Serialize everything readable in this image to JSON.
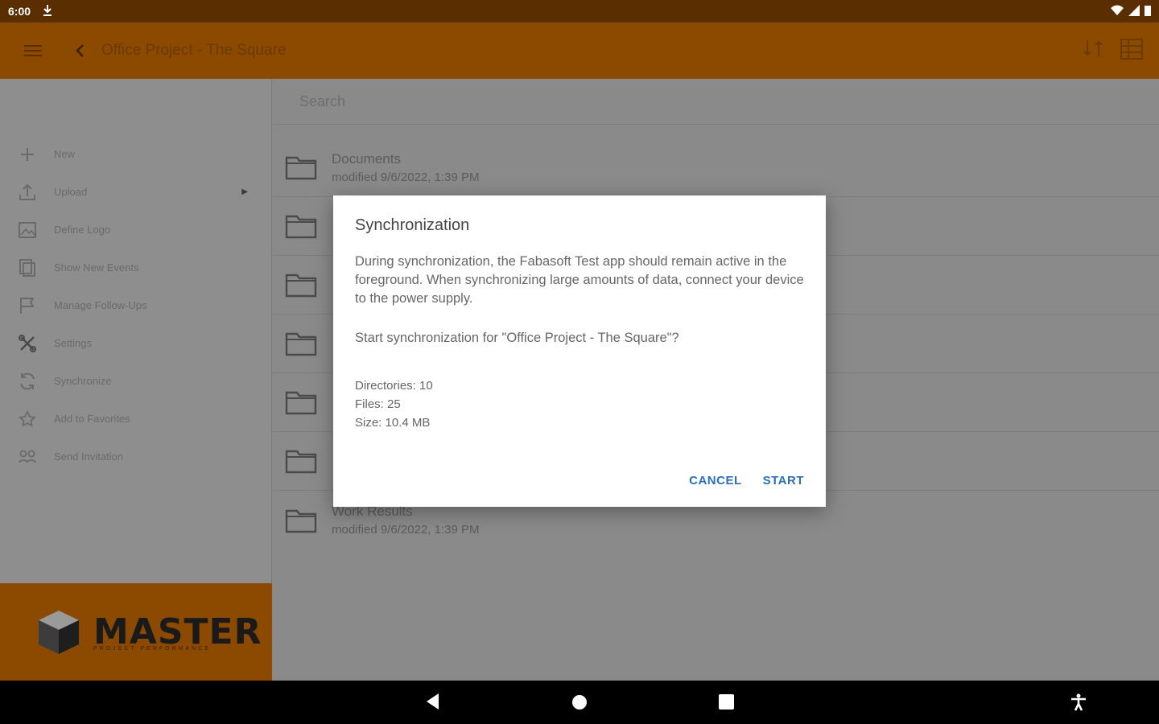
{
  "status_bar": {
    "time": "6:00"
  },
  "app_bar": {
    "title": "Office Project - The Square"
  },
  "sidebar": {
    "items": [
      {
        "label": "New"
      },
      {
        "label": "Upload"
      },
      {
        "label": "Define Logo"
      },
      {
        "label": "Show New Events"
      },
      {
        "label": "Manage Follow-Ups"
      },
      {
        "label": "Settings"
      },
      {
        "label": "Synchronize"
      },
      {
        "label": "Add to Favorites"
      },
      {
        "label": "Send Invitation"
      }
    ],
    "brand": {
      "word": "MASTER",
      "tagline": "PROJECT PERFORMANCE"
    }
  },
  "main": {
    "search_placeholder": "Search",
    "rows": [
      {
        "name": "Documents",
        "meta": "modified 9/6/2022, 1:39 PM"
      },
      {
        "name": "",
        "meta": ""
      },
      {
        "name": "",
        "meta": ""
      },
      {
        "name": "",
        "meta": ""
      },
      {
        "name": "",
        "meta": ""
      },
      {
        "name": "",
        "meta": ""
      },
      {
        "name": "Work Results",
        "meta": "modified 9/6/2022, 1:39 PM"
      }
    ]
  },
  "dialog": {
    "title": "Synchronization",
    "body": "During synchronization, the Fabasoft Test app should remain active in the foreground. When synchronizing large amounts of data, connect your device to the power supply.",
    "question": "Start synchronization for \"Office Project - The Square\"?",
    "directories": "Directories: 10",
    "files": "Files: 25",
    "size": "Size: 10.4 MB",
    "cancel_label": "CANCEL",
    "start_label": "START",
    "accent_color": "#2a6fb8"
  }
}
